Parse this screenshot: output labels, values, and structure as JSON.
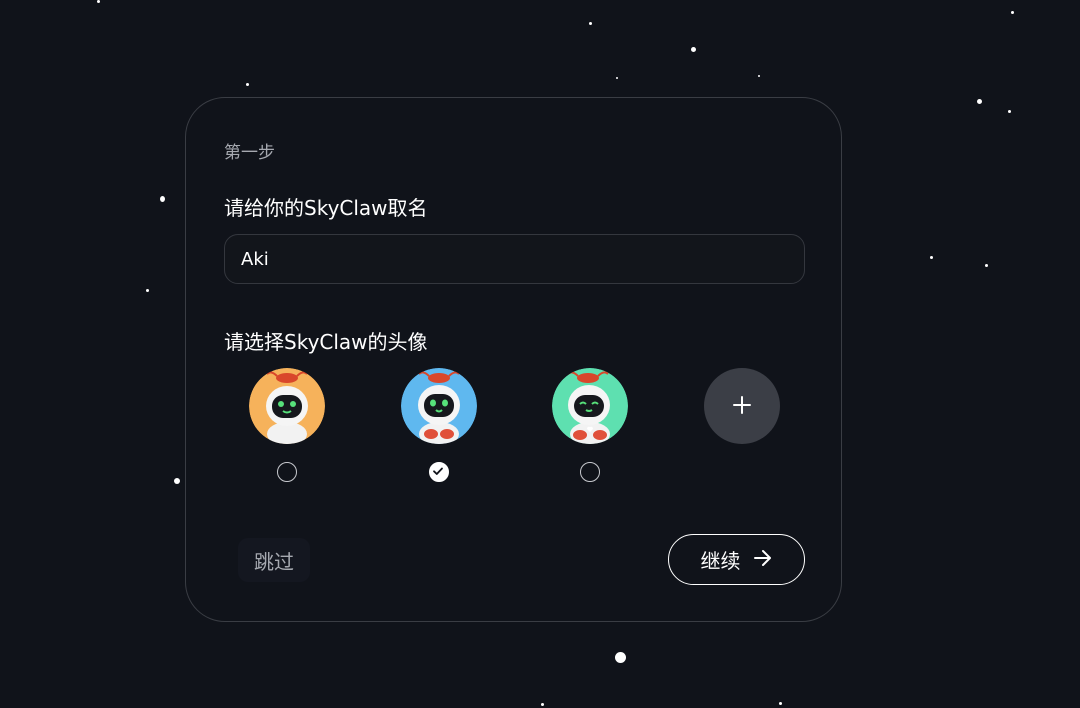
{
  "dialog": {
    "step_label": "第一步",
    "name_question": "请给你的SkyClaw取名",
    "name_value": "Aki",
    "avatar_question": "请选择SkyClaw的头像"
  },
  "avatars": [
    {
      "icon": "robot-lobster-avatar-orange",
      "background": "#f6b25b",
      "selected": false
    },
    {
      "icon": "robot-lobster-avatar-blue",
      "background": "#5fb8ef",
      "selected": true
    },
    {
      "icon": "robot-lobster-avatar-green",
      "background": "#5ee0b0",
      "selected": false
    }
  ],
  "add_avatar": {
    "icon": "plus-icon"
  },
  "actions": {
    "skip_label": "跳过",
    "continue_label": "继续",
    "continue_icon": "arrow-right-icon"
  },
  "colors": {
    "background": "#10131a",
    "card_border": "#3a3d44",
    "muted_text": "#a6a9b0"
  }
}
